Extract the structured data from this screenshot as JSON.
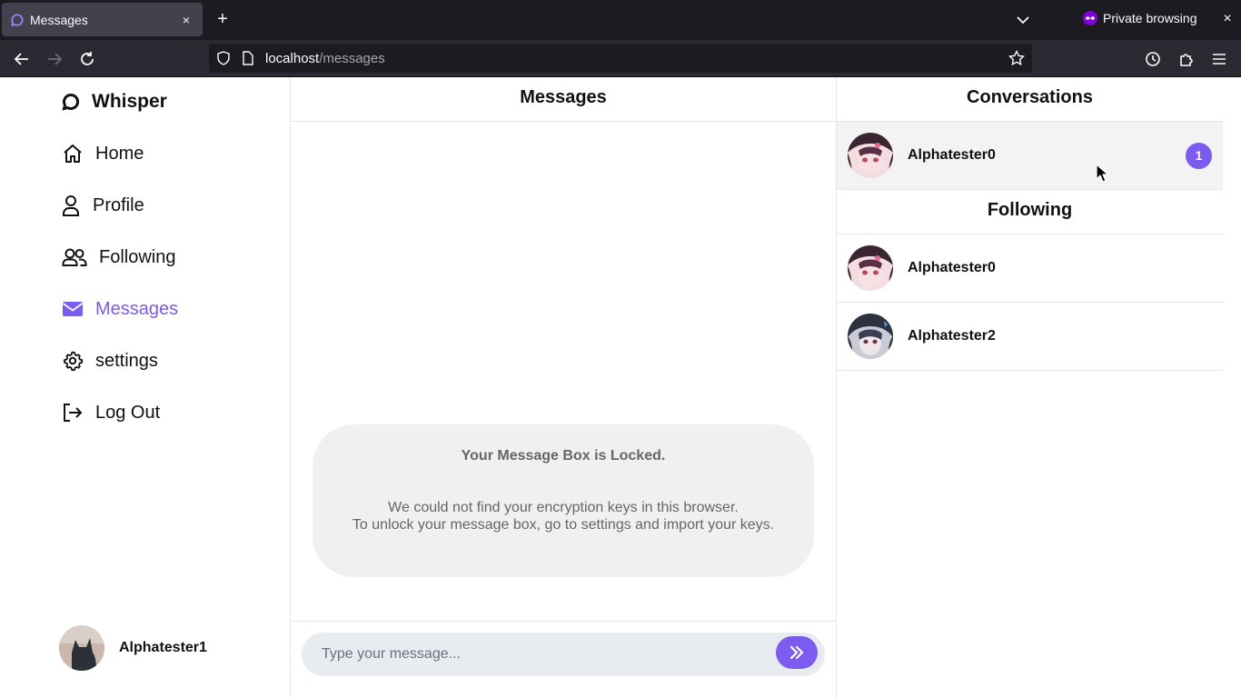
{
  "browser": {
    "tab_title": "Messages",
    "tab_close": "×",
    "new_tab": "+",
    "private_label": "Private browsing",
    "window_close": "×",
    "url_host": "localhost",
    "url_path": "/messages"
  },
  "sidebar": {
    "brand": "Whisper",
    "items": [
      {
        "label": "Home",
        "icon": "home-icon"
      },
      {
        "label": "Profile",
        "icon": "user-icon"
      },
      {
        "label": "Following",
        "icon": "users-icon"
      },
      {
        "label": "Messages",
        "icon": "envelope-icon",
        "active": true
      },
      {
        "label": "settings",
        "icon": "gear-icon"
      },
      {
        "label": "Log Out",
        "icon": "logout-icon"
      }
    ],
    "current_user": "Alphatester1"
  },
  "main": {
    "title": "Messages",
    "locked": {
      "title": "Your Message Box is Locked.",
      "line1": "We could not find your encryption keys in this browser.",
      "line2": "To unlock your message box, go to settings and import your keys."
    },
    "composer": {
      "placeholder": "Type your message..."
    }
  },
  "conversations": {
    "title": "Conversations",
    "items": [
      {
        "name": "Alphatester0",
        "unread": "1"
      }
    ]
  },
  "following": {
    "title": "Following",
    "items": [
      {
        "name": "Alphatester0"
      },
      {
        "name": "Alphatester2"
      }
    ]
  },
  "colors": {
    "accent": "#7c5cf0",
    "chrome_dark": "#1c1b22",
    "chrome_toolbar": "#2b2a33"
  }
}
